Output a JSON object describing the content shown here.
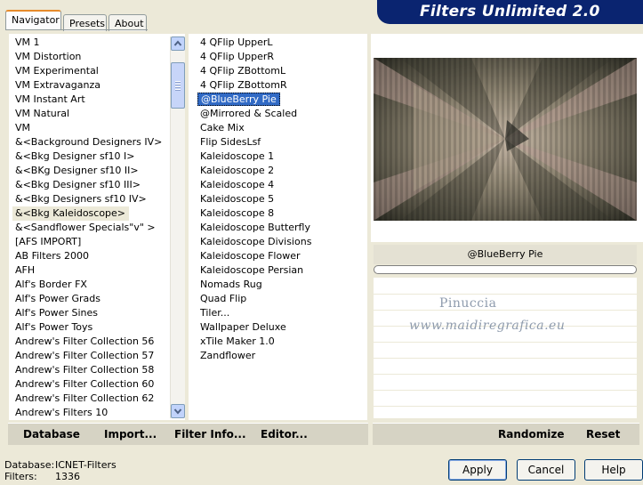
{
  "tabs": [
    {
      "label": "Navigator",
      "active": true
    },
    {
      "label": "Presets",
      "active": false
    },
    {
      "label": "About",
      "active": false
    }
  ],
  "header": {
    "title": "Filters Unlimited 2.0",
    "bg_color": "#0a2470"
  },
  "categories": {
    "items": [
      "VM 1",
      "VM Distortion",
      "VM Experimental",
      "VM Extravaganza",
      "VM Instant Art",
      "VM Natural",
      "VM",
      "&<Background Designers IV>",
      "&<Bkg Designer sf10 I>",
      "&<BKg Designer sf10 II>",
      "&<Bkg Designer sf10 III>",
      "&<Bkg Designers sf10 IV>",
      "&<Bkg Kaleidoscope>",
      "&<Sandflower Specials\"v\" >",
      "[AFS IMPORT]",
      "AB Filters 2000",
      "AFH",
      "Alf's Border FX",
      "Alf's Power Grads",
      "Alf's Power Sines",
      "Alf's Power Toys",
      "Andrew's Filter Collection 56",
      "Andrew's Filter Collection 57",
      "Andrew's Filter Collection 58",
      "Andrew's Filter Collection 60",
      "Andrew's Filter Collection 62",
      "Andrew's Filters 10"
    ],
    "selected": "&<Bkg Kaleidoscope>"
  },
  "filters": {
    "items": [
      "4 QFlip UpperL",
      "4 QFlip UpperR",
      "4 QFlip ZBottomL",
      "4 QFlip ZBottomR",
      "@BlueBerry Pie",
      "@Mirrored & Scaled",
      "Cake Mix",
      "Flip SidesLsf",
      "Kaleidoscope 1",
      "Kaleidoscope 2",
      "Kaleidoscope 4",
      "Kaleidoscope 5",
      "Kaleidoscope 8",
      "Kaleidoscope Butterfly",
      "Kaleidoscope Divisions",
      "Kaleidoscope Flower",
      "Kaleidoscope Persian",
      "Nomads Rug",
      "Quad Flip",
      "Tiler...",
      "Wallpaper Deluxe",
      "xTile Maker 1.0",
      "Zandflower"
    ],
    "selected": "@BlueBerry Pie"
  },
  "left_toolbar": {
    "database": "Database",
    "import": "Import...",
    "filter_info": "Filter Info...",
    "editor": "Editor..."
  },
  "right_toolbar": {
    "randomize": "Randomize",
    "reset": "Reset"
  },
  "preview": {
    "filter_name": "@BlueBerry Pie"
  },
  "watermark": {
    "line1": "Pinuccia",
    "line2": "www.maidiregrafica.eu"
  },
  "status": {
    "database_label": "Database:",
    "database_value": "ICNET-Filters",
    "filters_label": "Filters:",
    "filters_value": "1336"
  },
  "buttons": {
    "apply": "Apply",
    "cancel": "Cancel",
    "help": "Help"
  },
  "icons": {
    "scroll_up": "arrow-up-icon",
    "scroll_down": "arrow-down-icon",
    "scroll_grip": "grip-icon"
  }
}
